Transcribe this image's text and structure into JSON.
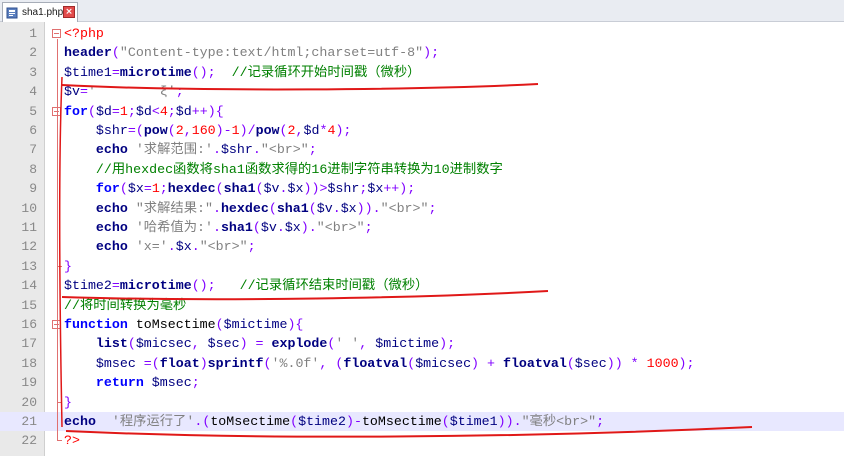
{
  "tab": {
    "label": "sha1.php",
    "close": "×",
    "icon": "php-file-icon"
  },
  "editor": {
    "current_line": 21,
    "lines": [
      {
        "n": "1",
        "fold": "open",
        "tokens": [
          {
            "t": "<?php",
            "c": "tag"
          }
        ]
      },
      {
        "n": "2",
        "tokens": [
          {
            "t": "header",
            "c": "fn"
          },
          {
            "t": "(",
            "c": "op"
          },
          {
            "t": "\"Content-type:text/html;charset=utf-8\"",
            "c": "str"
          },
          {
            "t": ");",
            "c": "op"
          }
        ]
      },
      {
        "n": "3",
        "tokens": [
          {
            "t": "$time1",
            "c": "var"
          },
          {
            "t": "=",
            "c": "op"
          },
          {
            "t": "microtime",
            "c": "fn"
          },
          {
            "t": "();  ",
            "c": "op"
          },
          {
            "t": "//记录循环开始时间戳（微秒）",
            "c": "cmt"
          }
        ]
      },
      {
        "n": "4",
        "tokens": [
          {
            "t": "$v",
            "c": "var"
          },
          {
            "t": "=",
            "c": "op"
          },
          {
            "t": "'        ξ'",
            "c": "str"
          },
          {
            "t": ";",
            "c": "op"
          }
        ]
      },
      {
        "n": "5",
        "fold": "open",
        "tokens": [
          {
            "t": "for",
            "c": "kw"
          },
          {
            "t": "(",
            "c": "op"
          },
          {
            "t": "$d",
            "c": "var"
          },
          {
            "t": "=",
            "c": "op"
          },
          {
            "t": "1",
            "c": "num"
          },
          {
            "t": ";",
            "c": "op"
          },
          {
            "t": "$d",
            "c": "var"
          },
          {
            "t": "<",
            "c": "op"
          },
          {
            "t": "4",
            "c": "num"
          },
          {
            "t": ";",
            "c": "op"
          },
          {
            "t": "$d",
            "c": "var"
          },
          {
            "t": "++){",
            "c": "op"
          }
        ]
      },
      {
        "n": "6",
        "tokens": [
          {
            "t": "    ",
            "c": "txt"
          },
          {
            "t": "$shr",
            "c": "var"
          },
          {
            "t": "=(",
            "c": "op"
          },
          {
            "t": "pow",
            "c": "fn"
          },
          {
            "t": "(",
            "c": "op"
          },
          {
            "t": "2",
            "c": "num"
          },
          {
            "t": ",",
            "c": "op"
          },
          {
            "t": "160",
            "c": "num"
          },
          {
            "t": ")-",
            "c": "op"
          },
          {
            "t": "1",
            "c": "num"
          },
          {
            "t": ")/",
            "c": "op"
          },
          {
            "t": "pow",
            "c": "fn"
          },
          {
            "t": "(",
            "c": "op"
          },
          {
            "t": "2",
            "c": "num"
          },
          {
            "t": ",",
            "c": "op"
          },
          {
            "t": "$d",
            "c": "var"
          },
          {
            "t": "*",
            "c": "op"
          },
          {
            "t": "4",
            "c": "num"
          },
          {
            "t": ");",
            "c": "op"
          }
        ]
      },
      {
        "n": "7",
        "tokens": [
          {
            "t": "    ",
            "c": "txt"
          },
          {
            "t": "echo",
            "c": "fn"
          },
          {
            "t": " ",
            "c": "txt"
          },
          {
            "t": "'求解范围:'",
            "c": "str"
          },
          {
            "t": ".",
            "c": "op"
          },
          {
            "t": "$shr",
            "c": "var"
          },
          {
            "t": ".",
            "c": "op"
          },
          {
            "t": "\"<br>\"",
            "c": "str"
          },
          {
            "t": ";",
            "c": "op"
          }
        ]
      },
      {
        "n": "8",
        "tokens": [
          {
            "t": "    ",
            "c": "txt"
          },
          {
            "t": "//用hexdec函数将sha1函数求得的16进制字符串转换为10进制数字",
            "c": "cmt"
          }
        ]
      },
      {
        "n": "9",
        "tokens": [
          {
            "t": "    ",
            "c": "txt"
          },
          {
            "t": "for",
            "c": "kw"
          },
          {
            "t": "(",
            "c": "op"
          },
          {
            "t": "$x",
            "c": "var"
          },
          {
            "t": "=",
            "c": "op"
          },
          {
            "t": "1",
            "c": "num"
          },
          {
            "t": ";",
            "c": "op"
          },
          {
            "t": "hexdec",
            "c": "fn"
          },
          {
            "t": "(",
            "c": "op"
          },
          {
            "t": "sha1",
            "c": "fn"
          },
          {
            "t": "(",
            "c": "op"
          },
          {
            "t": "$v",
            "c": "var"
          },
          {
            "t": ".",
            "c": "op"
          },
          {
            "t": "$x",
            "c": "var"
          },
          {
            "t": "))>",
            "c": "op"
          },
          {
            "t": "$shr",
            "c": "var"
          },
          {
            "t": ";",
            "c": "op"
          },
          {
            "t": "$x",
            "c": "var"
          },
          {
            "t": "++);",
            "c": "op"
          }
        ]
      },
      {
        "n": "10",
        "tokens": [
          {
            "t": "    ",
            "c": "txt"
          },
          {
            "t": "echo",
            "c": "fn"
          },
          {
            "t": " ",
            "c": "txt"
          },
          {
            "t": "\"求解结果:\"",
            "c": "str"
          },
          {
            "t": ".",
            "c": "op"
          },
          {
            "t": "hexdec",
            "c": "fn"
          },
          {
            "t": "(",
            "c": "op"
          },
          {
            "t": "sha1",
            "c": "fn"
          },
          {
            "t": "(",
            "c": "op"
          },
          {
            "t": "$v",
            "c": "var"
          },
          {
            "t": ".",
            "c": "op"
          },
          {
            "t": "$x",
            "c": "var"
          },
          {
            "t": ")).",
            "c": "op"
          },
          {
            "t": "\"<br>\"",
            "c": "str"
          },
          {
            "t": ";",
            "c": "op"
          }
        ]
      },
      {
        "n": "11",
        "tokens": [
          {
            "t": "    ",
            "c": "txt"
          },
          {
            "t": "echo",
            "c": "fn"
          },
          {
            "t": " ",
            "c": "txt"
          },
          {
            "t": "'哈希值为:'",
            "c": "str"
          },
          {
            "t": ".",
            "c": "op"
          },
          {
            "t": "sha1",
            "c": "fn"
          },
          {
            "t": "(",
            "c": "op"
          },
          {
            "t": "$v",
            "c": "var"
          },
          {
            "t": ".",
            "c": "op"
          },
          {
            "t": "$x",
            "c": "var"
          },
          {
            "t": ").",
            "c": "op"
          },
          {
            "t": "\"<br>\"",
            "c": "str"
          },
          {
            "t": ";",
            "c": "op"
          }
        ]
      },
      {
        "n": "12",
        "tokens": [
          {
            "t": "    ",
            "c": "txt"
          },
          {
            "t": "echo",
            "c": "fn"
          },
          {
            "t": " ",
            "c": "txt"
          },
          {
            "t": "'x='",
            "c": "str"
          },
          {
            "t": ".",
            "c": "op"
          },
          {
            "t": "$x",
            "c": "var"
          },
          {
            "t": ".",
            "c": "op"
          },
          {
            "t": "\"<br>\"",
            "c": "str"
          },
          {
            "t": ";",
            "c": "op"
          }
        ]
      },
      {
        "n": "13",
        "fold": "end",
        "tokens": [
          {
            "t": "}",
            "c": "op"
          }
        ]
      },
      {
        "n": "14",
        "tokens": [
          {
            "t": "$time2",
            "c": "var"
          },
          {
            "t": "=",
            "c": "op"
          },
          {
            "t": "microtime",
            "c": "fn"
          },
          {
            "t": "();   ",
            "c": "op"
          },
          {
            "t": "//记录循环结束时间戳（微秒）",
            "c": "cmt"
          }
        ]
      },
      {
        "n": "15",
        "tokens": [
          {
            "t": "//将时间转换为毫秒",
            "c": "cmt"
          }
        ]
      },
      {
        "n": "16",
        "fold": "open",
        "tokens": [
          {
            "t": "function",
            "c": "kw"
          },
          {
            "t": " toMsectime",
            "c": "txt"
          },
          {
            "t": "(",
            "c": "op"
          },
          {
            "t": "$mictime",
            "c": "var"
          },
          {
            "t": "){",
            "c": "op"
          }
        ]
      },
      {
        "n": "17",
        "tokens": [
          {
            "t": "    ",
            "c": "txt"
          },
          {
            "t": "list",
            "c": "fn"
          },
          {
            "t": "(",
            "c": "op"
          },
          {
            "t": "$micsec",
            "c": "var"
          },
          {
            "t": ", ",
            "c": "op"
          },
          {
            "t": "$sec",
            "c": "var"
          },
          {
            "t": ") = ",
            "c": "op"
          },
          {
            "t": "explode",
            "c": "fn"
          },
          {
            "t": "(",
            "c": "op"
          },
          {
            "t": "' '",
            "c": "str"
          },
          {
            "t": ", ",
            "c": "op"
          },
          {
            "t": "$mictime",
            "c": "var"
          },
          {
            "t": ");",
            "c": "op"
          }
        ]
      },
      {
        "n": "18",
        "tokens": [
          {
            "t": "    ",
            "c": "txt"
          },
          {
            "t": "$msec",
            "c": "var"
          },
          {
            "t": " =(",
            "c": "op"
          },
          {
            "t": "float",
            "c": "fn"
          },
          {
            "t": ")",
            "c": "op"
          },
          {
            "t": "sprintf",
            "c": "fn"
          },
          {
            "t": "(",
            "c": "op"
          },
          {
            "t": "'%.0f'",
            "c": "str"
          },
          {
            "t": ", (",
            "c": "op"
          },
          {
            "t": "floatval",
            "c": "fn"
          },
          {
            "t": "(",
            "c": "op"
          },
          {
            "t": "$micsec",
            "c": "var"
          },
          {
            "t": ") + ",
            "c": "op"
          },
          {
            "t": "floatval",
            "c": "fn"
          },
          {
            "t": "(",
            "c": "op"
          },
          {
            "t": "$sec",
            "c": "var"
          },
          {
            "t": ")) * ",
            "c": "op"
          },
          {
            "t": "1000",
            "c": "num"
          },
          {
            "t": ");",
            "c": "op"
          }
        ]
      },
      {
        "n": "19",
        "tokens": [
          {
            "t": "    ",
            "c": "txt"
          },
          {
            "t": "return",
            "c": "kw"
          },
          {
            "t": " ",
            "c": "txt"
          },
          {
            "t": "$msec",
            "c": "var"
          },
          {
            "t": ";",
            "c": "op"
          }
        ]
      },
      {
        "n": "20",
        "fold": "end",
        "tokens": [
          {
            "t": "}",
            "c": "op"
          }
        ]
      },
      {
        "n": "21",
        "tokens": [
          {
            "t": "echo",
            "c": "fn"
          },
          {
            "t": "  ",
            "c": "txt"
          },
          {
            "t": "'程序运行了'",
            "c": "str"
          },
          {
            "t": ".(",
            "c": "op"
          },
          {
            "t": "toMsectime",
            "c": "txt"
          },
          {
            "t": "(",
            "c": "op"
          },
          {
            "t": "$time2",
            "c": "var"
          },
          {
            "t": ")-",
            "c": "op"
          },
          {
            "t": "toMsectime",
            "c": "txt"
          },
          {
            "t": "(",
            "c": "op"
          },
          {
            "t": "$time1",
            "c": "var"
          },
          {
            "t": ")).",
            "c": "op"
          },
          {
            "t": "\"毫秒<br>\"",
            "c": "str"
          },
          {
            "t": ";",
            "c": "op"
          }
        ]
      },
      {
        "n": "22",
        "fold": "end",
        "tokens": [
          {
            "t": "?>",
            "c": "tag"
          }
        ]
      }
    ]
  },
  "colors": {
    "annotation_stroke": "#e01818",
    "current_line_bg": "#e8e8ff",
    "fold_marker": "#e07070"
  }
}
